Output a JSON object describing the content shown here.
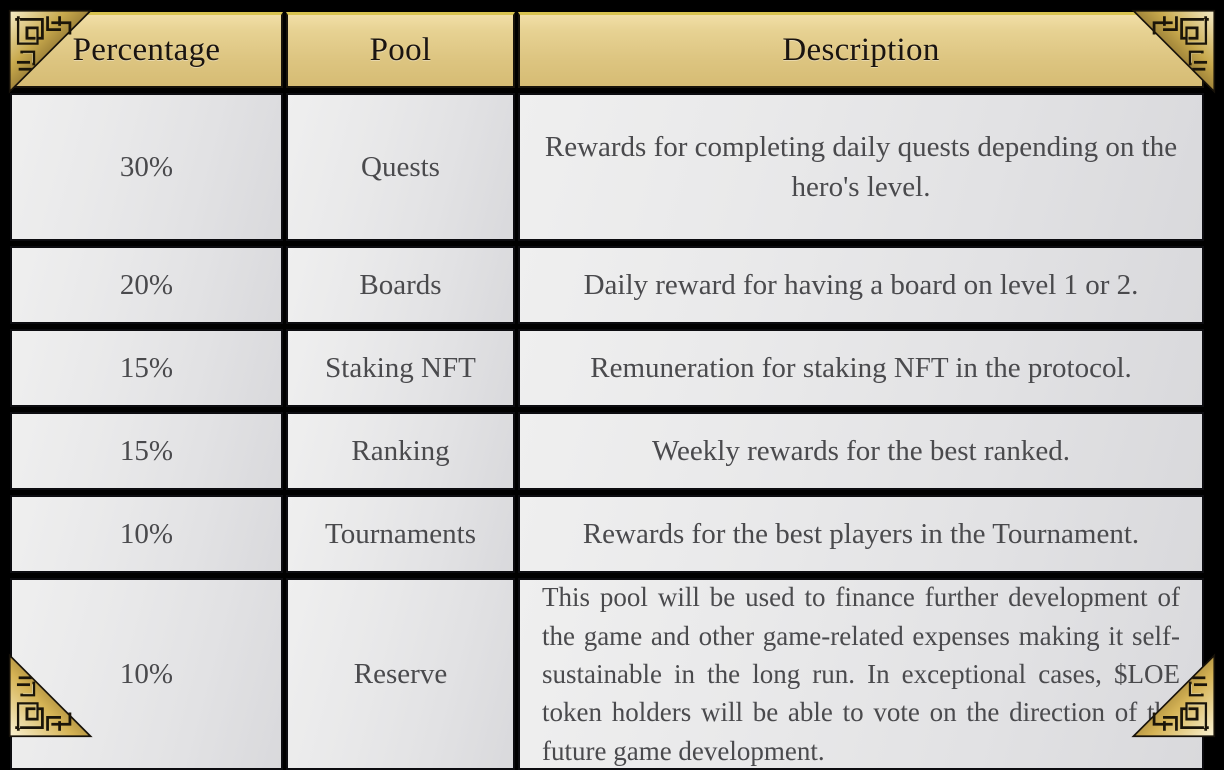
{
  "table": {
    "columns": [
      {
        "key": "percentage",
        "label": "Percentage"
      },
      {
        "key": "pool",
        "label": "Pool"
      },
      {
        "key": "description",
        "label": "Description"
      }
    ],
    "rows": [
      {
        "percentage": "30%",
        "pool": "Quests",
        "description": "Rewards for completing daily quests depending on the hero's level."
      },
      {
        "percentage": "20%",
        "pool": "Boards",
        "description": "Daily reward for having a board on level 1 or 2."
      },
      {
        "percentage": "15%",
        "pool": "Staking NFT",
        "description": "Remuneration for staking NFT in the protocol."
      },
      {
        "percentage": "15%",
        "pool": "Ranking",
        "description": "Weekly rewards for the best ranked."
      },
      {
        "percentage": "10%",
        "pool": "Tournaments",
        "description": "Rewards for the best players in the Tournament."
      },
      {
        "percentage": "10%",
        "pool": "Reserve",
        "description": "This pool will be used to finance further development of the game and other game-related expenses making it self-sustainable in the long run. In exceptional cases, $LOE token holders will be able to vote on the direction of the future game development."
      }
    ]
  },
  "decor": {
    "corner_top_left": "celtic-knot-corner-icon",
    "corner_top_right": "celtic-knot-corner-icon",
    "corner_bottom_left": "celtic-knot-corner-icon",
    "corner_bottom_right": "celtic-knot-corner-icon"
  },
  "colors": {
    "header_gold": "#ddc581",
    "header_gold_light": "#f2dfa7",
    "header_top_edge": "#d9c34f",
    "cell_gray": "#e6e6e8",
    "border_dark": "#0c0c10",
    "text_body": "#4a4a4d",
    "text_header": "#1a1410",
    "background": "#000000",
    "ornament_gold": "#c9a94e"
  }
}
